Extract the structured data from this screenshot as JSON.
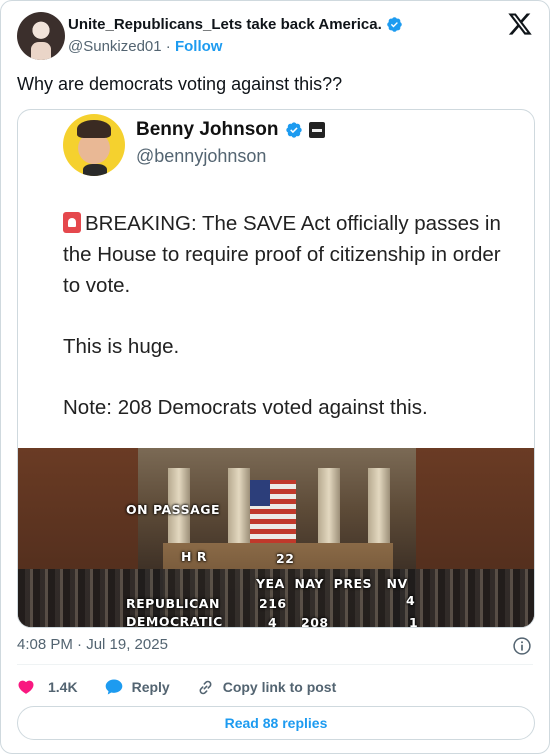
{
  "author": {
    "display_name": "Unite_Republicans_Lets take back America.",
    "handle": "@Sunkized01",
    "separator": "·",
    "follow_label": "Follow"
  },
  "tweet": {
    "text": "Why are democrats voting against this??",
    "timestamp": "4:08 PM · Jul 19, 2025"
  },
  "quoted_image": {
    "name": "Benny Johnson",
    "handle": "@bennyjohnson",
    "breaking": "BREAKING: The SAVE Act officially passes in the House to require proof of citizenship in order to vote.",
    "line2": "This is huge.",
    "line3": "Note: 208 Democrats voted against this.",
    "overlay": {
      "on_passage": "ON PASSAGE",
      "hr": "H R",
      "hr_number": "22",
      "columns": "YEA  NAY  PRES   NV",
      "republican_label": "REPUBLICAN",
      "republican_yea": "216",
      "republican_nv": "4",
      "democratic_label": "DEMOCRATIC",
      "democratic_yea": "4",
      "democratic_nay": "208",
      "democratic_nv": "1"
    }
  },
  "actions": {
    "like_count": "1.4K",
    "reply_label": "Reply",
    "copy_label": "Copy link to post"
  },
  "read_replies_label": "Read 88 replies",
  "colors": {
    "accent": "#1d9bf0",
    "like": "#f91880",
    "text": "#0f1419",
    "muted": "#536471"
  },
  "icons": [
    "verified-badge-icon",
    "x-logo-icon",
    "info-icon",
    "heart-icon",
    "reply-bubble-icon",
    "link-icon",
    "siren-icon"
  ]
}
